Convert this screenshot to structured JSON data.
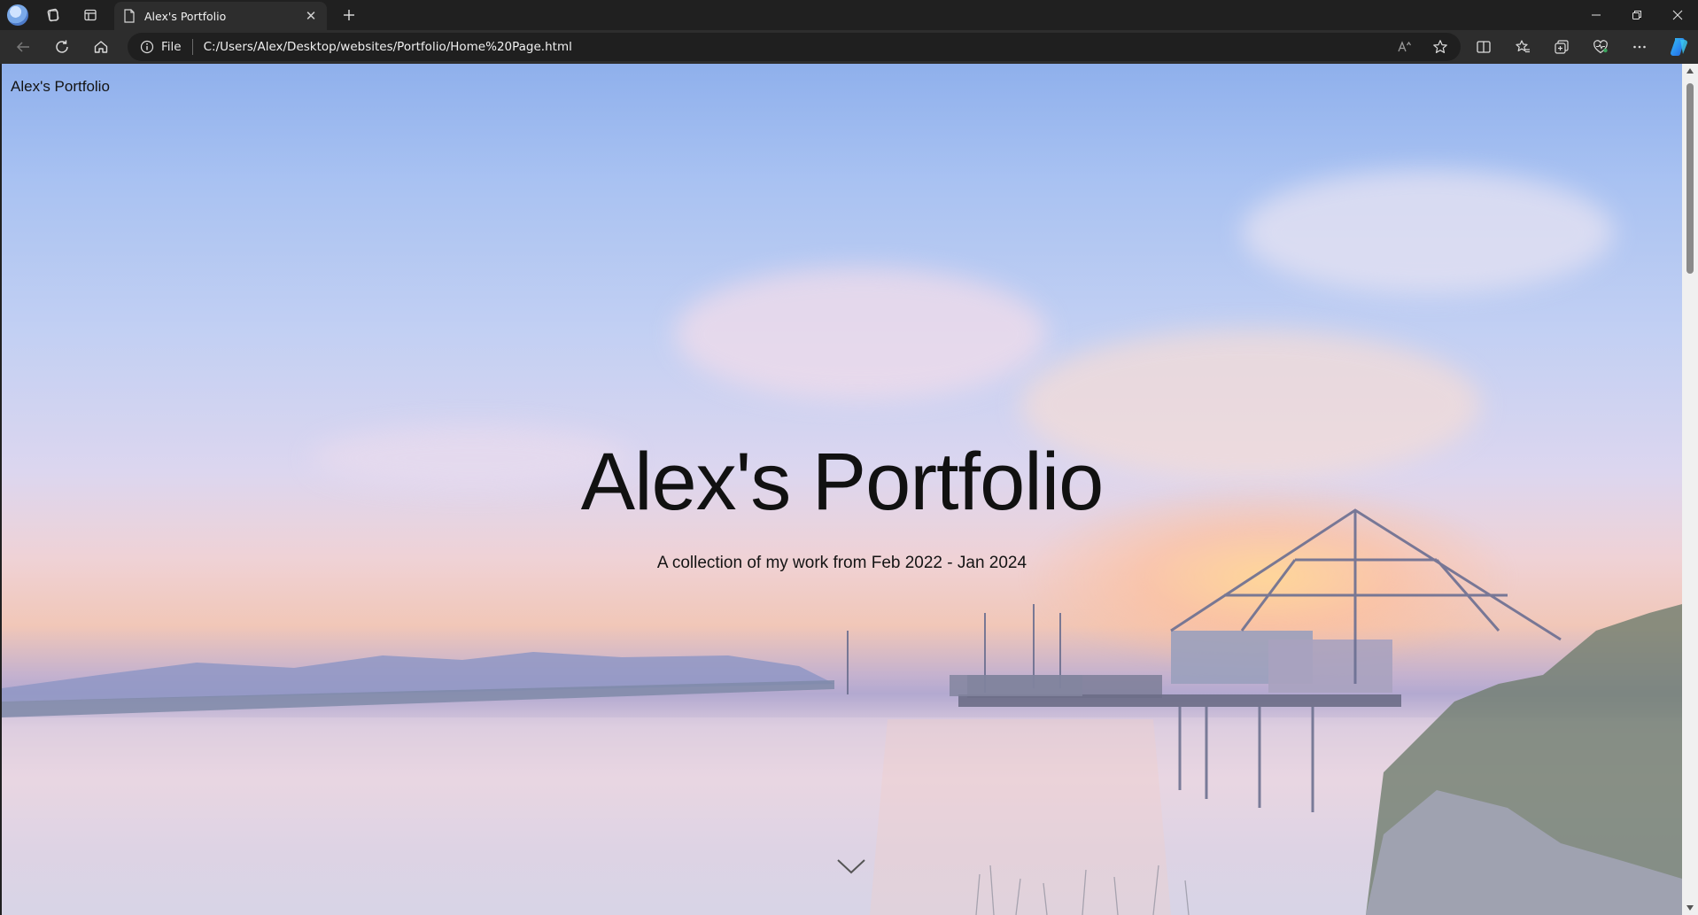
{
  "browser": {
    "tab": {
      "title": "Alex's Portfolio"
    },
    "address": {
      "scheme_label": "File",
      "url": "C:/Users/Alex/Desktop/websites/Portfolio/Home%20Page.html"
    },
    "icons": {
      "profile": "profile-avatar",
      "workspaces": "workspaces-icon",
      "tab_actions": "tab-actions-icon",
      "page": "page-icon",
      "close_tab": "close-icon",
      "new_tab": "plus-icon",
      "back": "back-arrow-icon",
      "refresh": "refresh-icon",
      "home": "home-icon",
      "info": "info-icon",
      "read_aloud": "read-aloud-icon",
      "favorite": "star-icon",
      "split_screen": "split-screen-icon",
      "favorites": "favorites-icon",
      "collections": "collections-icon",
      "browser_essentials": "heart-pulse-icon",
      "more": "more-icon",
      "copilot": "copilot-icon"
    },
    "tab_close_glyph": "✕"
  },
  "page": {
    "brand": "Alex's Portfolio",
    "hero_title": "Alex's Portfolio",
    "hero_subtitle": "A collection of my work from Feb 2022 - Jan 2024",
    "scroll_icon": "chevron-down-icon"
  },
  "colors": {
    "chrome_dark": "#202020",
    "chrome_mid": "#2d2d2d",
    "omnibox": "#1f1f1f",
    "copilot_accent": "#2b8cf0"
  }
}
